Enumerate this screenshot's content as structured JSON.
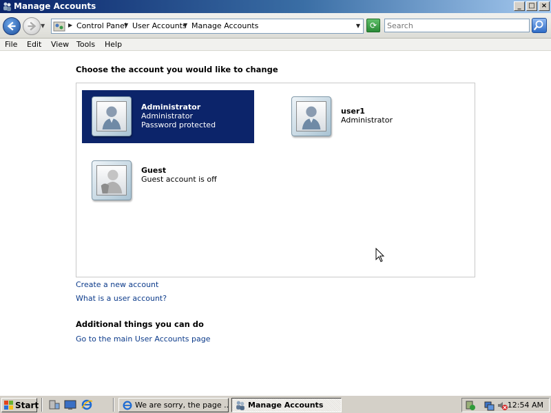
{
  "window": {
    "title": "Manage Accounts",
    "buttons": {
      "minimize": "_",
      "maximize": "□",
      "close": "×"
    }
  },
  "address_bar": {
    "breadcrumbs": [
      "Control Panel",
      "User Accounts",
      "Manage Accounts"
    ],
    "search_placeholder": "Search"
  },
  "menu": [
    "File",
    "Edit",
    "View",
    "Tools",
    "Help"
  ],
  "main": {
    "heading": "Choose the account you would like to change",
    "accounts": [
      {
        "name": "Administrator",
        "line1": "Administrator",
        "line2": "Password protected",
        "selected": true,
        "icon": "user-avatar-icon"
      },
      {
        "name": "user1",
        "line1": "Administrator",
        "line2": "",
        "selected": false,
        "icon": "user-avatar-icon"
      },
      {
        "name": "Guest",
        "line1": "Guest account is off",
        "line2": "",
        "selected": false,
        "icon": "guest-avatar-icon"
      }
    ],
    "links": [
      "Create a new account",
      "What is a user account?"
    ],
    "additional_heading": "Additional things you can do",
    "additional_links": [
      "Go to the main User Accounts page"
    ]
  },
  "taskbar": {
    "start_label": "Start",
    "tasks": [
      {
        "label": "We are sorry, the page ...",
        "active": false
      },
      {
        "label": "Manage Accounts",
        "active": true
      }
    ],
    "clock": "12:54 AM"
  },
  "colors": {
    "selection": "#0c246a",
    "link": "#0b3a8a",
    "titlebar_start": "#0a246a"
  }
}
